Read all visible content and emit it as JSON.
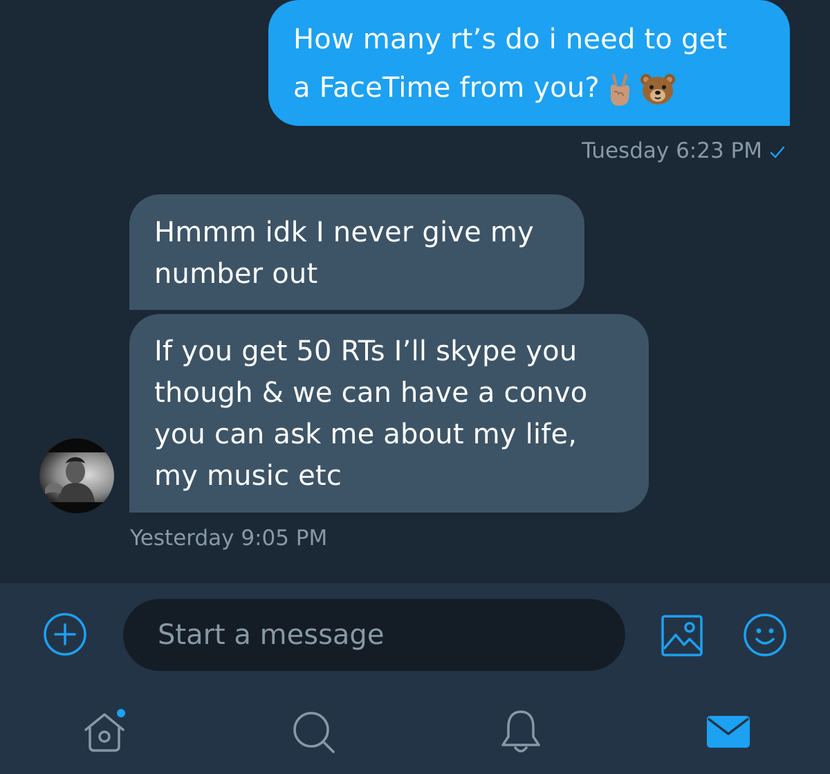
{
  "colors": {
    "background": "#1b2836",
    "sent_bubble": "#1da1f2",
    "received_bubble": "#3d5466",
    "timestamp": "#8899a6",
    "accent": "#1da1f2",
    "inactive_icon": "#8899a6",
    "composer_bar": "#243447",
    "input_field": "#141d26"
  },
  "messages": [
    {
      "direction": "sent",
      "lines": [
        "How many rt’s do i need to get",
        "a FaceTime from you?"
      ],
      "emojis": [
        "victory-hand-emoji",
        "bear-face-emoji"
      ]
    },
    {
      "direction": "received",
      "lines": [
        "Hmmm idk I never give my",
        "number out"
      ]
    },
    {
      "direction": "received",
      "lines": [
        "If you get 50 RTs I’ll skype you",
        "though & we can have a convo",
        "you can ask me about my life,",
        "my music etc"
      ]
    }
  ],
  "timestamps": {
    "sent": "Tuesday 6:23 PM",
    "received": "Yesterday 9:05 PM"
  },
  "icons": {
    "sent_status": "checkmark-icon",
    "add": "add-circle-icon",
    "image": "image-icon",
    "emoji": "smiley-icon",
    "tabs": [
      "home-icon",
      "search-icon",
      "notifications-icon",
      "messages-icon"
    ]
  },
  "composer": {
    "placeholder": "Start a message"
  },
  "tabbar": {
    "active_tab": "messages",
    "home_has_new_indicator": true
  }
}
